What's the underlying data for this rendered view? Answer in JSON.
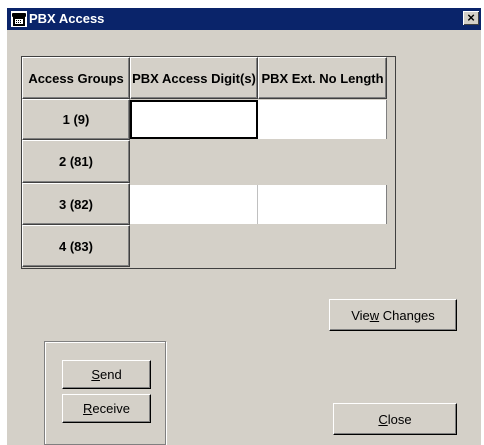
{
  "window": {
    "title": "PBX Access",
    "icon": "telephone-icon",
    "close_glyph": "×"
  },
  "table": {
    "headers": [
      "Access Groups",
      "PBX Access Digit(s)",
      "PBX Ext. No Length"
    ],
    "rows": [
      {
        "label": "1 (9)",
        "access_digits": "",
        "ext_length": ""
      },
      {
        "label": "2 (81)"
      },
      {
        "label": "3 (82)",
        "access_digits": "",
        "ext_length": ""
      },
      {
        "label": "4 (83)"
      }
    ]
  },
  "buttons": {
    "view_changes": {
      "before": "Vie",
      "mnemonic": "w",
      "after": " Changes"
    },
    "send": {
      "before": "",
      "mnemonic": "S",
      "after": "end"
    },
    "receive": {
      "before": "",
      "mnemonic": "R",
      "after": "eceive"
    },
    "close": {
      "before": "",
      "mnemonic": "C",
      "after": "lose"
    }
  }
}
